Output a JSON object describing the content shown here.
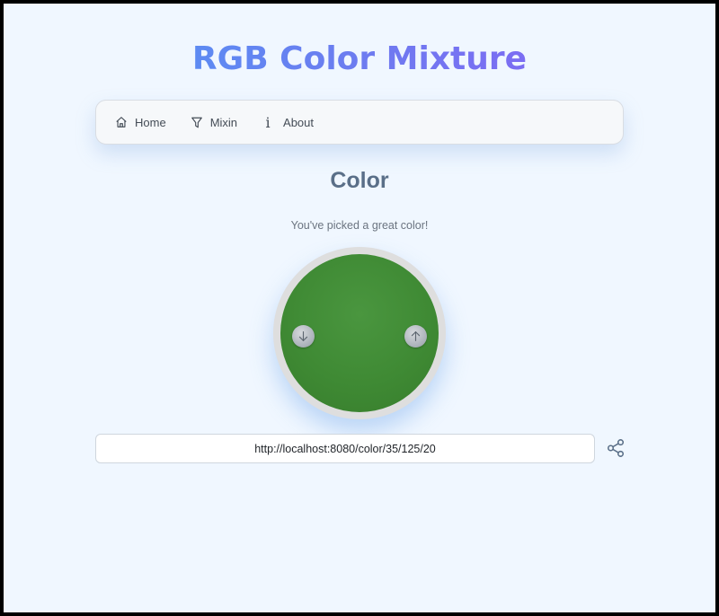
{
  "app": {
    "title": "RGB Color Mixture"
  },
  "nav": {
    "items": [
      {
        "label": "Home",
        "icon": "home-icon"
      },
      {
        "label": "Mixin",
        "icon": "funnel-icon"
      },
      {
        "label": "About",
        "icon": "info-icon"
      }
    ],
    "info_glyph": "i"
  },
  "main": {
    "title": "Color",
    "message": "You've picked a great color!",
    "color": {
      "r": 35,
      "g": 125,
      "b": 20,
      "swatch_hex": "#3f8a34"
    },
    "url": "http://localhost:8080/color/35/125/20",
    "share_icon": "share-icon",
    "down_icon": "arrow-down-icon",
    "up_icon": "arrow-up-icon"
  },
  "colors": {
    "title_gradient_start": "#4b9bf5",
    "title_gradient_end": "#8b5cf6",
    "page_background": "#f0f7ff",
    "heading": "#5a6f88"
  }
}
